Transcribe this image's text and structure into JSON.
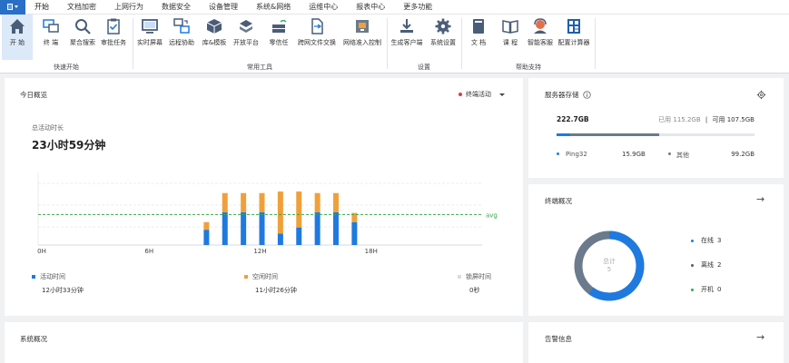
{
  "menu": {
    "tabs": [
      "开始",
      "文档加密",
      "上网行为",
      "数据安全",
      "设备管理",
      "系统&网络",
      "运维中心",
      "报表中心",
      "更多功能"
    ]
  },
  "ribbon": {
    "groups": {
      "quick": "快速开始",
      "tools": "常用工具",
      "settings": "设置",
      "help": "帮助支持"
    },
    "buttons": {
      "start": "开 始",
      "terminal": "终 端",
      "search": "聚合搜索",
      "approve": "审批任务",
      "screen": "实时屏幕",
      "remote": "远程协助",
      "library": "库&模板",
      "platform": "开放平台",
      "zerotrust": "零信任",
      "transfer": "跨网文件交换",
      "access": "网络准入控制",
      "client": "生成客户端",
      "sysset": "系统设置",
      "doc": "文 档",
      "course": "课 程",
      "service": "智能客服",
      "calc": "配置计算器"
    }
  },
  "today": {
    "title": "今日概览",
    "status": "终端活动",
    "total_label": "总活动时长",
    "total_value": "23小时59分钟",
    "legend": [
      {
        "label": "活动时间",
        "value": "12小时33分钟",
        "color": "#1f7ae0"
      },
      {
        "label": "空闲时间",
        "value": "11小时26分钟",
        "color": "#f0a03a"
      },
      {
        "label": "锁屏时间",
        "value": "0秒",
        "color": "#d9dce1"
      }
    ]
  },
  "chart_data": {
    "type": "bar",
    "stacked": true,
    "x_ticks": [
      "0H",
      "6H",
      "12H",
      "18H"
    ],
    "hours": [
      9,
      10,
      11,
      12,
      13,
      14,
      15,
      16,
      17
    ],
    "series": [
      {
        "name": "活动时间",
        "color": "#1f7ae0",
        "values": [
          20,
          43,
          43,
          43,
          15,
          23,
          43,
          43,
          30
        ]
      },
      {
        "name": "空闲时间",
        "color": "#f0a03a",
        "values": [
          10,
          25,
          25,
          25,
          55,
          47,
          25,
          25,
          12
        ]
      }
    ],
    "avg_label": "avg",
    "avg": 40,
    "ymax": 95,
    "grid": true
  },
  "storage": {
    "title": "服务器存储",
    "total": "222.7GB",
    "used_label": "已用",
    "used": "115.2GB",
    "free_label": "可用",
    "free": "107.5GB",
    "used_fraction": 0.517,
    "ping_fraction": 0.071,
    "rows": [
      {
        "label": "Ping32",
        "value": "15.9GB",
        "color": "#1f7ae0"
      },
      {
        "label": "其他",
        "value": "99.2GB",
        "color": "#6b7a8c"
      }
    ]
  },
  "terminals": {
    "title": "终端概况",
    "center_label": "总计",
    "center_value": "5",
    "items": [
      {
        "label": "在线",
        "value": "3",
        "color": "#1f7ae0"
      },
      {
        "label": "离线",
        "value": "2",
        "color": "#6b7a8c"
      },
      {
        "label": "开机",
        "value": "0",
        "color": "#2fa84f"
      }
    ]
  },
  "system": {
    "title": "系统概况"
  },
  "alarms": {
    "title": "告警信息"
  }
}
